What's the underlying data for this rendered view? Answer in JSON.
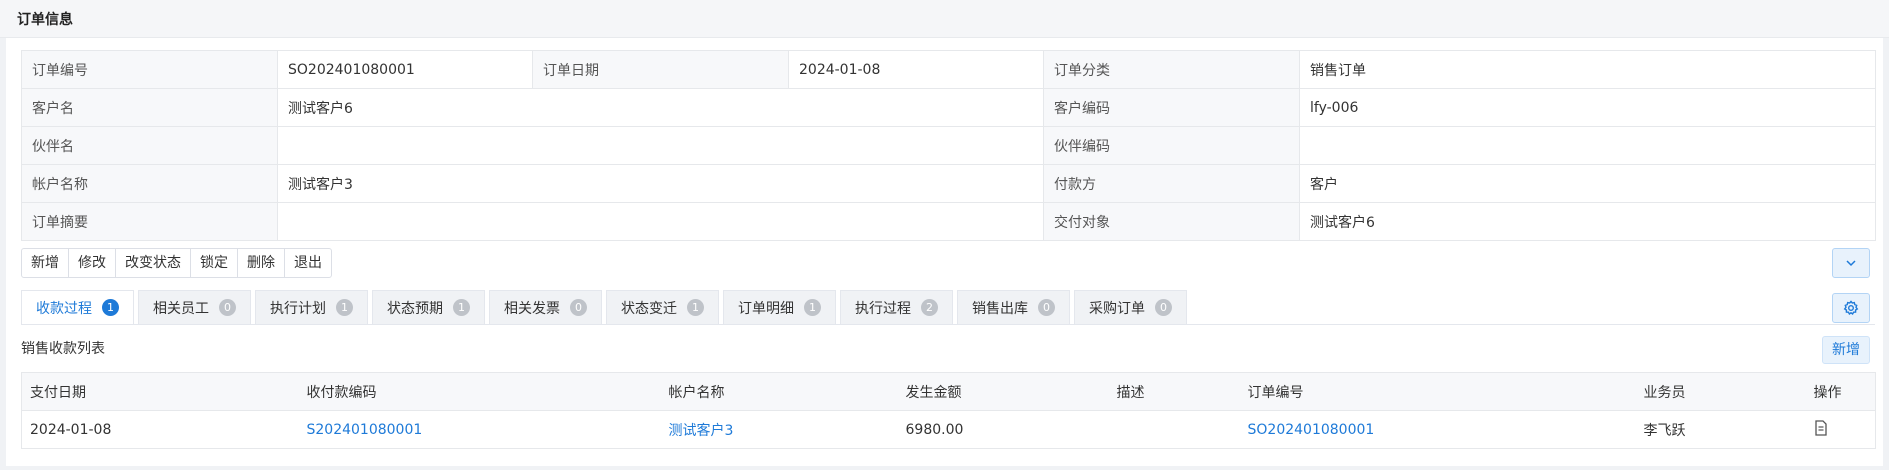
{
  "header": {
    "title": "订单信息"
  },
  "info": {
    "row1": {
      "l1": "订单编号",
      "v1": "SO202401080001",
      "l2": "订单日期",
      "v2": "2024-01-08",
      "l3": "订单分类",
      "v3": "销售订单"
    },
    "row2": {
      "l1": "客户名",
      "v1": "测试客户6",
      "l3": "客户编码",
      "v3": "lfy-006"
    },
    "row3": {
      "l1": "伙伴名",
      "v1": "",
      "l3": "伙伴编码",
      "v3": ""
    },
    "row4": {
      "l1": "帐户名称",
      "v1": "测试客户3",
      "l3": "付款方",
      "v3": "客户"
    },
    "row5": {
      "l1": "订单摘要",
      "v1": "",
      "l3": "交付对象",
      "v3": "测试客户6"
    }
  },
  "toolbar": {
    "add": "新增",
    "edit": "修改",
    "change_status": "改变状态",
    "lock": "锁定",
    "delete": "删除",
    "exit": "退出"
  },
  "tabs": [
    {
      "label": "收款过程",
      "count": "1"
    },
    {
      "label": "相关员工",
      "count": "0"
    },
    {
      "label": "执行计划",
      "count": "1"
    },
    {
      "label": "状态预期",
      "count": "1"
    },
    {
      "label": "相关发票",
      "count": "0"
    },
    {
      "label": "状态变迁",
      "count": "1"
    },
    {
      "label": "订单明细",
      "count": "1"
    },
    {
      "label": "执行过程",
      "count": "2"
    },
    {
      "label": "销售出库",
      "count": "0"
    },
    {
      "label": "采购订单",
      "count": "0"
    }
  ],
  "list": {
    "title": "销售收款列表",
    "add_label": "新增",
    "columns": [
      "支付日期",
      "收付款编码",
      "帐户名称",
      "发生金额",
      "描述",
      "订单编号",
      "业务员",
      "操作"
    ],
    "rows": [
      {
        "date": "2024-01-08",
        "code": "S202401080001",
        "account": "测试客户3",
        "amount": "6980.00",
        "desc": "",
        "order_no": "SO202401080001",
        "salesman": "李飞跃"
      }
    ]
  },
  "icons": {
    "expand": "chevron-down-icon",
    "settings": "gear-icon",
    "row_action": "document-icon"
  },
  "colors": {
    "accent": "#1e7ad8",
    "badge_inactive": "#bfc3c9"
  }
}
